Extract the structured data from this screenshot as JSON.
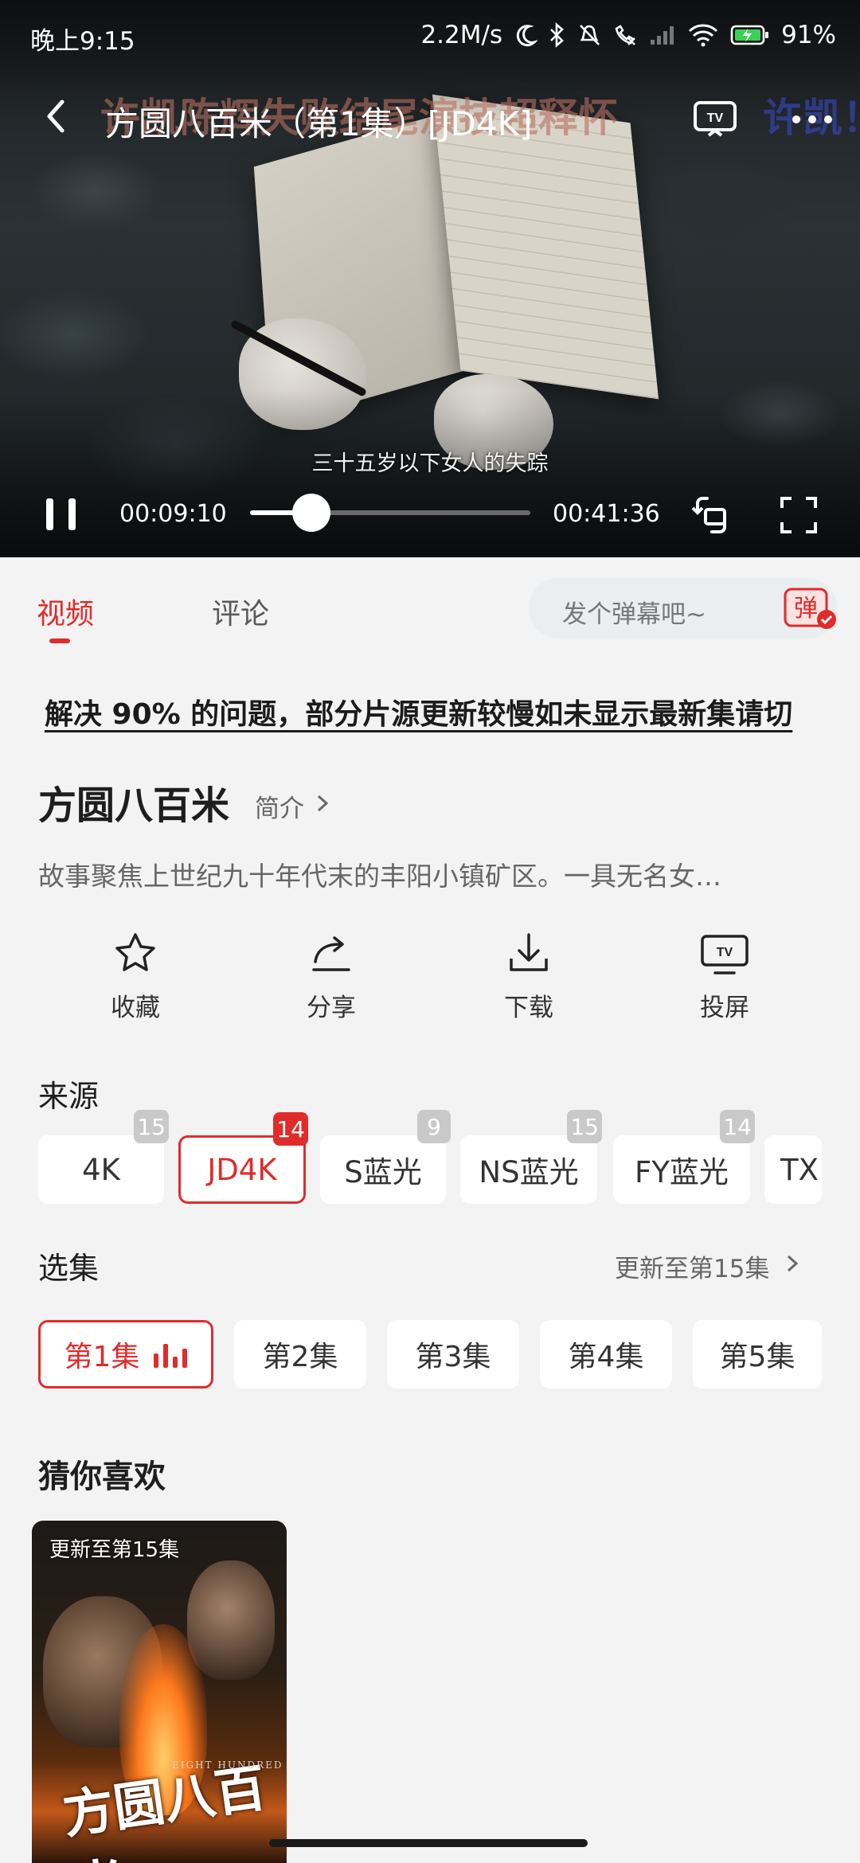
{
  "status_bar": {
    "time": "晚上9:15",
    "net_speed": "2.2M/s",
    "battery": "91%"
  },
  "player": {
    "title": "方圆八百米（第1集）[JD4K]",
    "danmu_left": "许凯陈辉失败结尾演技超释怀",
    "danmu_right": "许凯！",
    "subtitle": "三十五岁以下女人的失踪",
    "current_time": "00:09:10",
    "total_time": "00:41:36",
    "progress_fraction": 0.22
  },
  "tabs": [
    {
      "label": "视频",
      "active": true
    },
    {
      "label": "评论",
      "active": false
    }
  ],
  "danmu_input": {
    "placeholder": "发个弹幕吧~",
    "toggle_label": "弹"
  },
  "notice": "解决 90% 的问题，部分片源更新较慢如未显示最新集请切",
  "show": {
    "title": "方圆八百米",
    "intro_label": "简介",
    "description": "故事聚焦上世纪九十年代末的丰阳小镇矿区。一具无名女…"
  },
  "actions": [
    {
      "label": "收藏",
      "icon": "star-icon"
    },
    {
      "label": "分享",
      "icon": "share-icon"
    },
    {
      "label": "下载",
      "icon": "download-icon"
    },
    {
      "label": "投屏",
      "icon": "cast-tv-icon"
    }
  ],
  "sources": {
    "title": "来源",
    "items": [
      {
        "label": "4K",
        "count": "15",
        "active": false
      },
      {
        "label": "JD4K",
        "count": "14",
        "active": true
      },
      {
        "label": "S蓝光",
        "count": "9",
        "active": false
      },
      {
        "label": "NS蓝光",
        "count": "15",
        "active": false
      },
      {
        "label": "FY蓝光",
        "count": "14",
        "active": false
      },
      {
        "label": "TX",
        "count": "",
        "active": false
      }
    ]
  },
  "episodes": {
    "title": "选集",
    "update_label": "更新至第15集",
    "items": [
      {
        "label": "第1集",
        "active": true
      },
      {
        "label": "第2集",
        "active": false
      },
      {
        "label": "第3集",
        "active": false
      },
      {
        "label": "第4集",
        "active": false
      },
      {
        "label": "第5集",
        "active": false
      }
    ]
  },
  "recommend": {
    "title": "猜你喜欢",
    "cards": [
      {
        "badge": "更新至第15集",
        "poster_title": "方圆八百米",
        "poster_subtitle": "EIGHT HUNDRED"
      }
    ]
  },
  "colors": {
    "accent": "#e02b2b",
    "background": "#f3f3f3"
  }
}
